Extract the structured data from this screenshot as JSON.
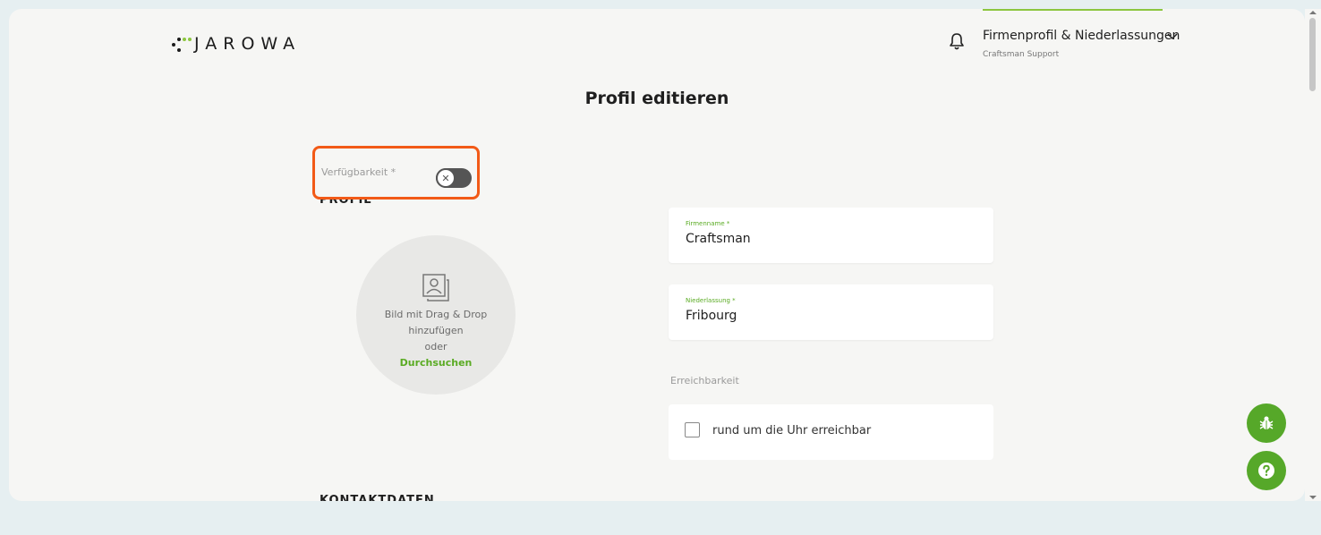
{
  "header": {
    "logo_text": "JAROWA",
    "profile_name": "Firmenprofil & Niederlassungen",
    "profile_sub": "Craftsman Support",
    "accent_color": "#8cc63f",
    "icons": [
      "bell-icon",
      "chevron-down-icon"
    ]
  },
  "page": {
    "title": "Profil editieren"
  },
  "availability": {
    "label": "Verfügbarkeit *",
    "toggle_state": "off",
    "highlight_color": "#f25a17"
  },
  "sections": {
    "profil": "PROFIL",
    "kontakt": "KONTAKTDATEN"
  },
  "upload": {
    "text": "Bild mit Drag & Drop hinzufügen",
    "or": "oder",
    "browse": "Durchsuchen"
  },
  "form": {
    "company": {
      "label": "Firmenname *",
      "value": "Craftsman"
    },
    "branch": {
      "label": "Niederlassung *",
      "value": "Fribourg"
    },
    "reach_label": "Erreichbarkeit",
    "reach_checkbox": "rund um die Uhr erreichbar",
    "reach_checked": false
  },
  "fabs": {
    "color": "#56a829",
    "icons": [
      "bug-icon",
      "help-icon"
    ]
  }
}
